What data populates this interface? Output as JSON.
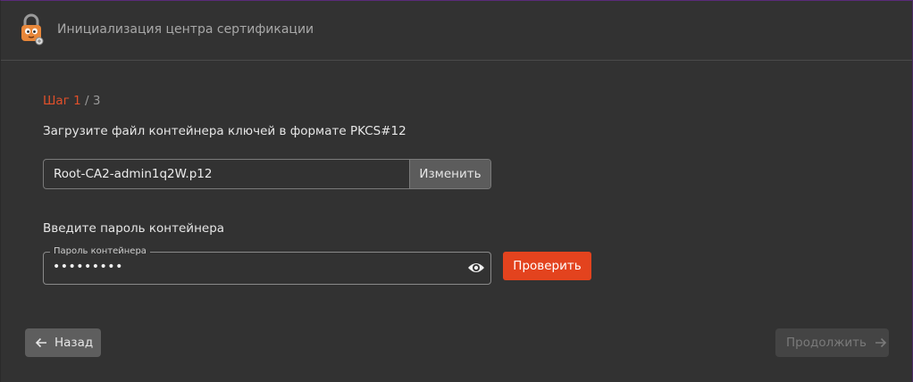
{
  "header": {
    "title": "Инициализация центра сертификации",
    "logo_icon": "lock-mascot-icon"
  },
  "step": {
    "current": "Шаг 1",
    "total": " / 3"
  },
  "file_section": {
    "label": "Загрузите файл контейнера ключей в формате PKCS#12",
    "file_name": "Root-CA2-admin1q2W.p12",
    "change_label": "Изменить"
  },
  "password_section": {
    "label": "Введите пароль контейнера",
    "field_label": "Пароль контейнера",
    "value": "•••••••••",
    "toggle_icon": "eye-icon",
    "check_label": "Проверить"
  },
  "nav": {
    "back_label": "Назад",
    "next_label": "Продолжить"
  },
  "colors": {
    "accent": "#e3431e",
    "background": "#323232"
  }
}
